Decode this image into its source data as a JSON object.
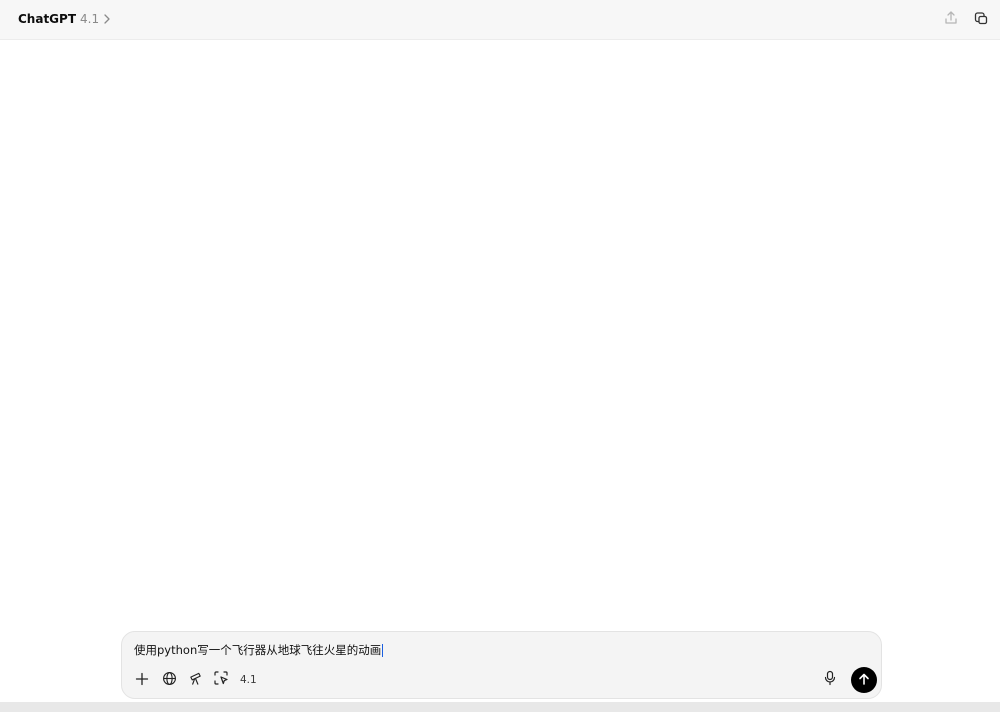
{
  "header": {
    "app_name": "ChatGPT",
    "model_version": "4.1",
    "icons": [
      "chevron-right-icon",
      "share-icon",
      "new-window-icon"
    ]
  },
  "composer": {
    "prompt_text": "使用python写一个飞行器从地球飞往火星的动画",
    "model_chip": "4.1",
    "tools": [
      "plus-icon",
      "globe-icon",
      "telescope-icon",
      "select-region-icon"
    ],
    "mic_icon": "mic-icon",
    "send_icon": "arrow-up-icon"
  },
  "colors": {
    "header_bg": "#f7f7f7",
    "composer_bg": "#f4f4f4",
    "send_bg": "#000000",
    "caret": "#1a5fe0"
  }
}
